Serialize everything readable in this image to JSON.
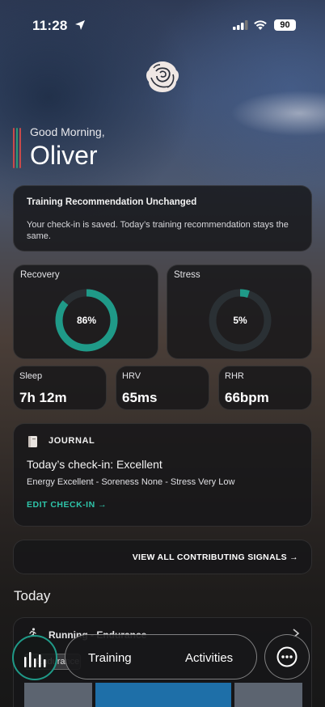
{
  "status_bar": {
    "time": "11:28",
    "battery": "90"
  },
  "greeting": {
    "salutation": "Good Morning,",
    "name": "Oliver"
  },
  "recommendation": {
    "title": "Training Recommendation Unchanged",
    "body": "Your check-in is saved. Today’s training recommendation stays the same."
  },
  "recovery": {
    "label": "Recovery",
    "value_text": "86%",
    "percent": 86,
    "color": "#1f9a88"
  },
  "stress": {
    "label": "Stress",
    "value_text": "5%",
    "percent": 5,
    "color": "#1f9a88"
  },
  "metrics": [
    {
      "label": "Sleep",
      "value": "7h 12m"
    },
    {
      "label": "HRV",
      "value": "65ms"
    },
    {
      "label": "RHR",
      "value": "66bpm"
    }
  ],
  "journal": {
    "title": "JOURNAL",
    "checkin": "Today’s check-in: Excellent",
    "detail": "Energy Excellent - Soreness None - Stress Very Low",
    "edit_label": "EDIT CHECK-IN →"
  },
  "signals": {
    "label": "VIEW ALL CONTRIBUTING SIGNALS →"
  },
  "today": {
    "heading": "Today"
  },
  "activity": {
    "title": "Running - Endurance",
    "chip": "Endurance"
  },
  "nav": {
    "training": "Training",
    "activities": "Activities"
  },
  "colors": {
    "accent": "#2ec4a9",
    "ring": "#1f9a88",
    "bar_highlight": "#1e6fa8"
  }
}
